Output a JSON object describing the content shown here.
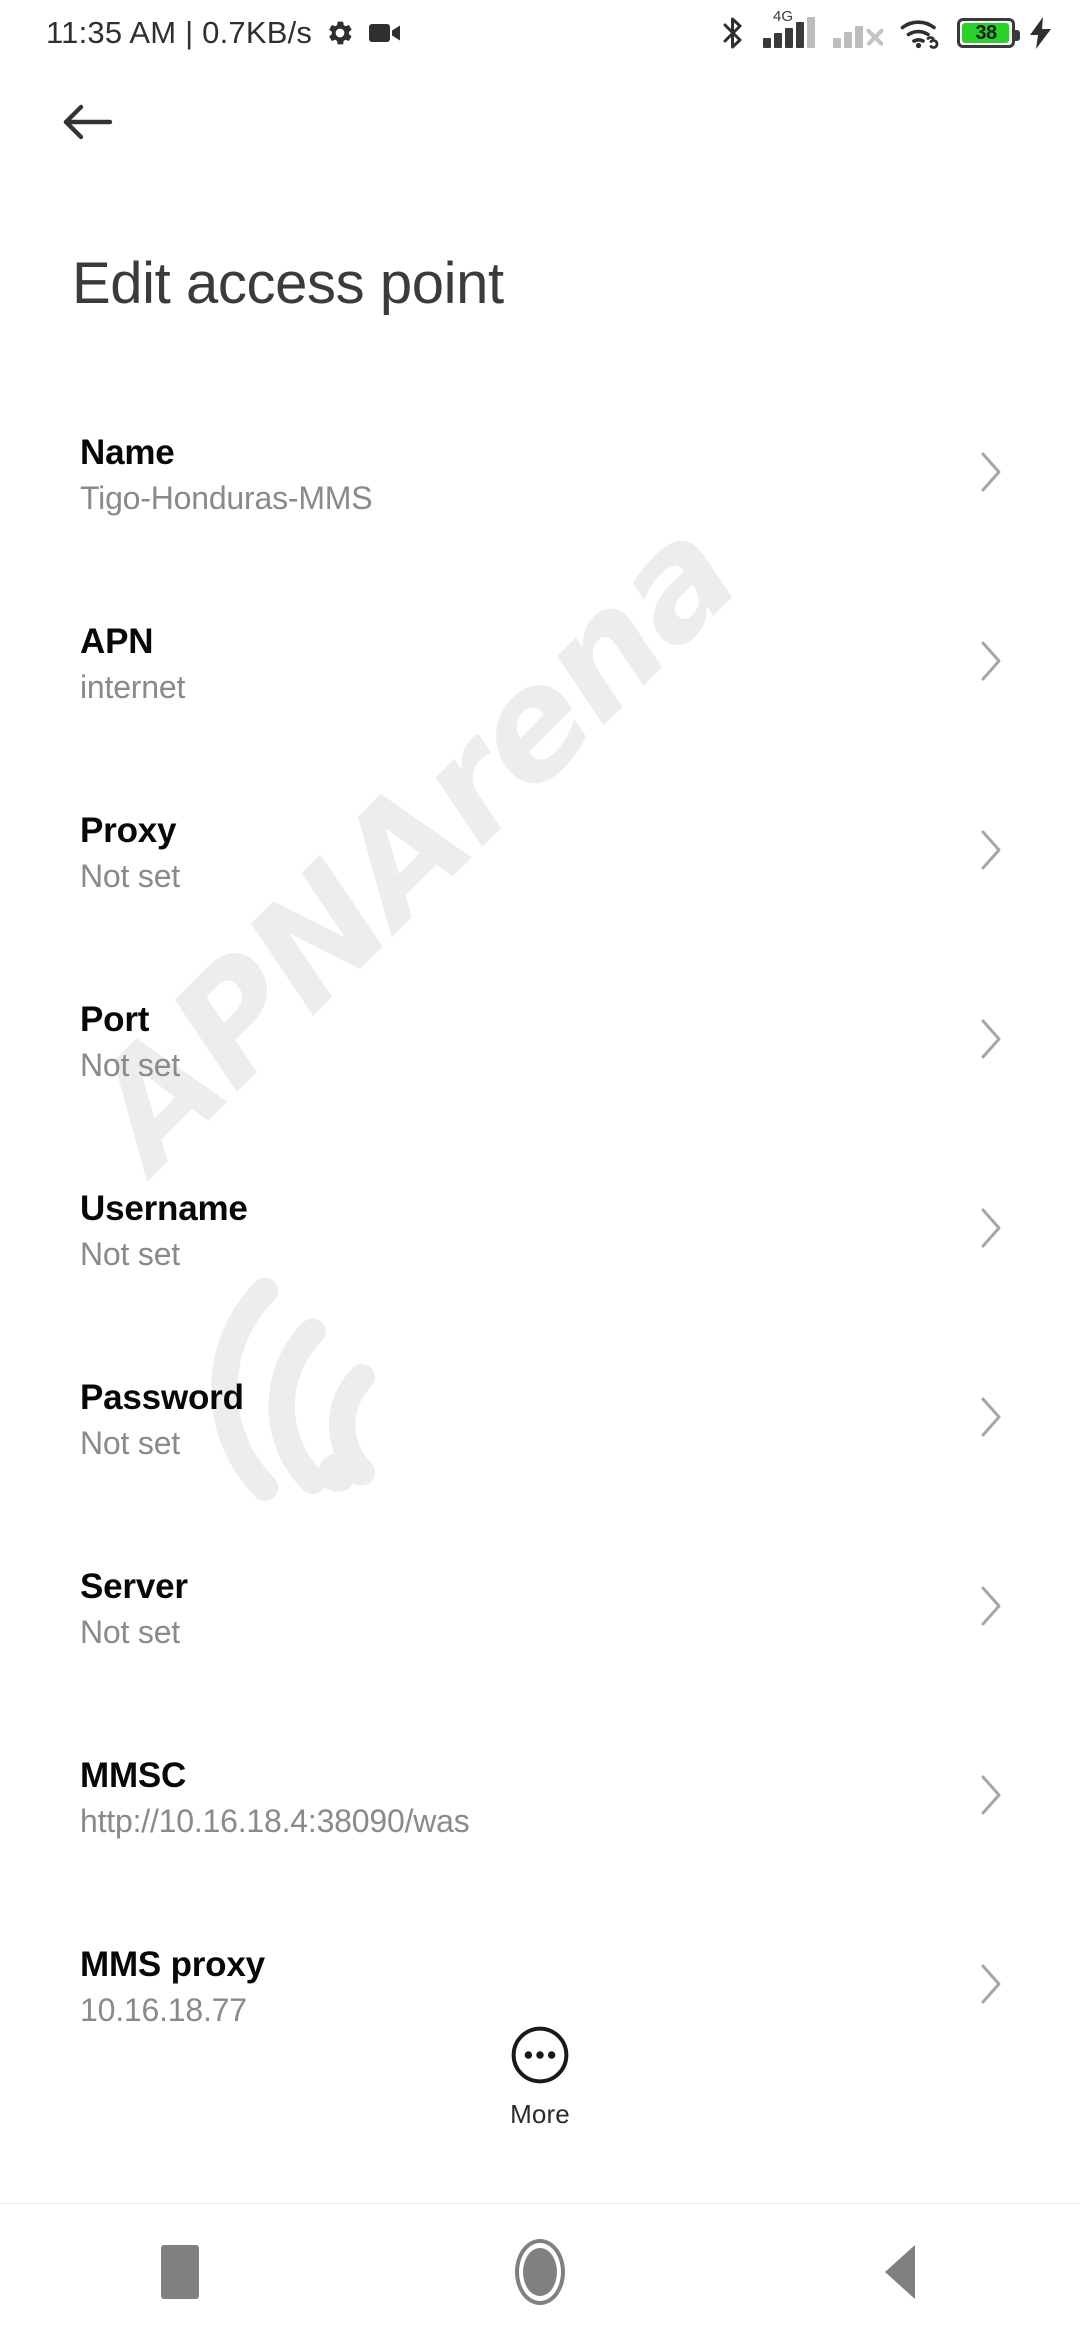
{
  "status_bar": {
    "clock": "11:35 AM | 0.7KB/s",
    "left_icons": [
      "gear-icon",
      "camcorder-icon"
    ],
    "right_icons": [
      "bluetooth-icon",
      "mobile-signal-icon",
      "mobile-signal-2-icon",
      "wifi-icon",
      "battery-icon",
      "charging-bolt-icon"
    ],
    "network_type": "4G",
    "battery_percent": "38",
    "battery_color": "#2bd12b",
    "sim1_bars": 4,
    "sim1_total_bars": 5,
    "sim2_bars": 2,
    "sim2_total_bars": 4,
    "sim2_no_service": true,
    "wifi_connected": true,
    "charging": true
  },
  "appbar": {
    "back_icon": "arrow-left-icon",
    "title": "Edit access point"
  },
  "watermark": {
    "text": "APNArena",
    "color": "#eceded"
  },
  "settings": {
    "rows": [
      {
        "label": "Name",
        "value": "Tigo-Honduras-MMS"
      },
      {
        "label": "APN",
        "value": "internet"
      },
      {
        "label": "Proxy",
        "value": "Not set"
      },
      {
        "label": "Port",
        "value": "Not set"
      },
      {
        "label": "Username",
        "value": "Not set"
      },
      {
        "label": "Password",
        "value": "Not set"
      },
      {
        "label": "Server",
        "value": "Not set"
      },
      {
        "label": "MMSC",
        "value": "http://10.16.18.4:38090/was"
      },
      {
        "label": "MMS proxy",
        "value": "10.16.18.77"
      }
    ]
  },
  "more_button": {
    "icon": "more-circle-icon",
    "label": "More"
  },
  "nav_bar": {
    "recents_label": "recents-square-icon",
    "home_label": "home-circle-icon",
    "back_label": "back-triangle-icon"
  }
}
